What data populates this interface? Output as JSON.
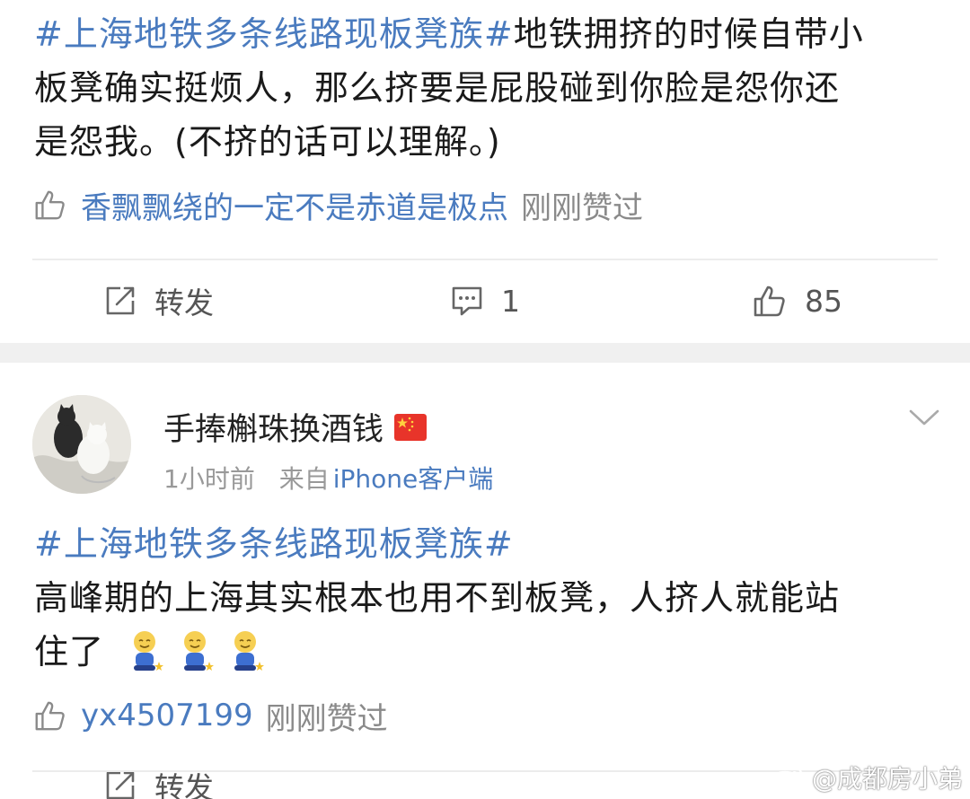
{
  "post1": {
    "topic": "#上海地铁多条线路现板凳族#",
    "lines": [
      "地铁拥挤的时候自带小",
      "板凳确实挺烦人，那么挤要是屁股碰到你脸是怨你还",
      "是怨我。(不挤的话可以理解。)"
    ],
    "liker": "香飘飘绕的一定不是赤道是极点",
    "liked_text": "刚刚赞过",
    "actions": {
      "repost": "转发",
      "comments": "1",
      "likes": "85"
    }
  },
  "post2": {
    "username": "手捧槲珠换酒钱",
    "time": "1小时前",
    "source_prefix": "来自",
    "source": "iPhone客户端",
    "topic": "#上海地铁多条线路现板凳族#",
    "line1": "高峰期的上海其实根本也用不到板凳，人挤人就能站",
    "line2": "住了",
    "liker": "yx4507199",
    "liked_text": "刚刚赞过",
    "actions": {
      "repost": "转发"
    }
  },
  "watermark": "@成都房小弟",
  "colors": {
    "link": "#4a7bbf",
    "muted": "#8a8a8a",
    "gap": "#f0f0f0"
  },
  "icons": [
    "like-icon",
    "repost-icon",
    "comment-icon",
    "chevron-down-icon",
    "china-flag-icon",
    "emoji-icon",
    "weibo-logo-icon"
  ]
}
